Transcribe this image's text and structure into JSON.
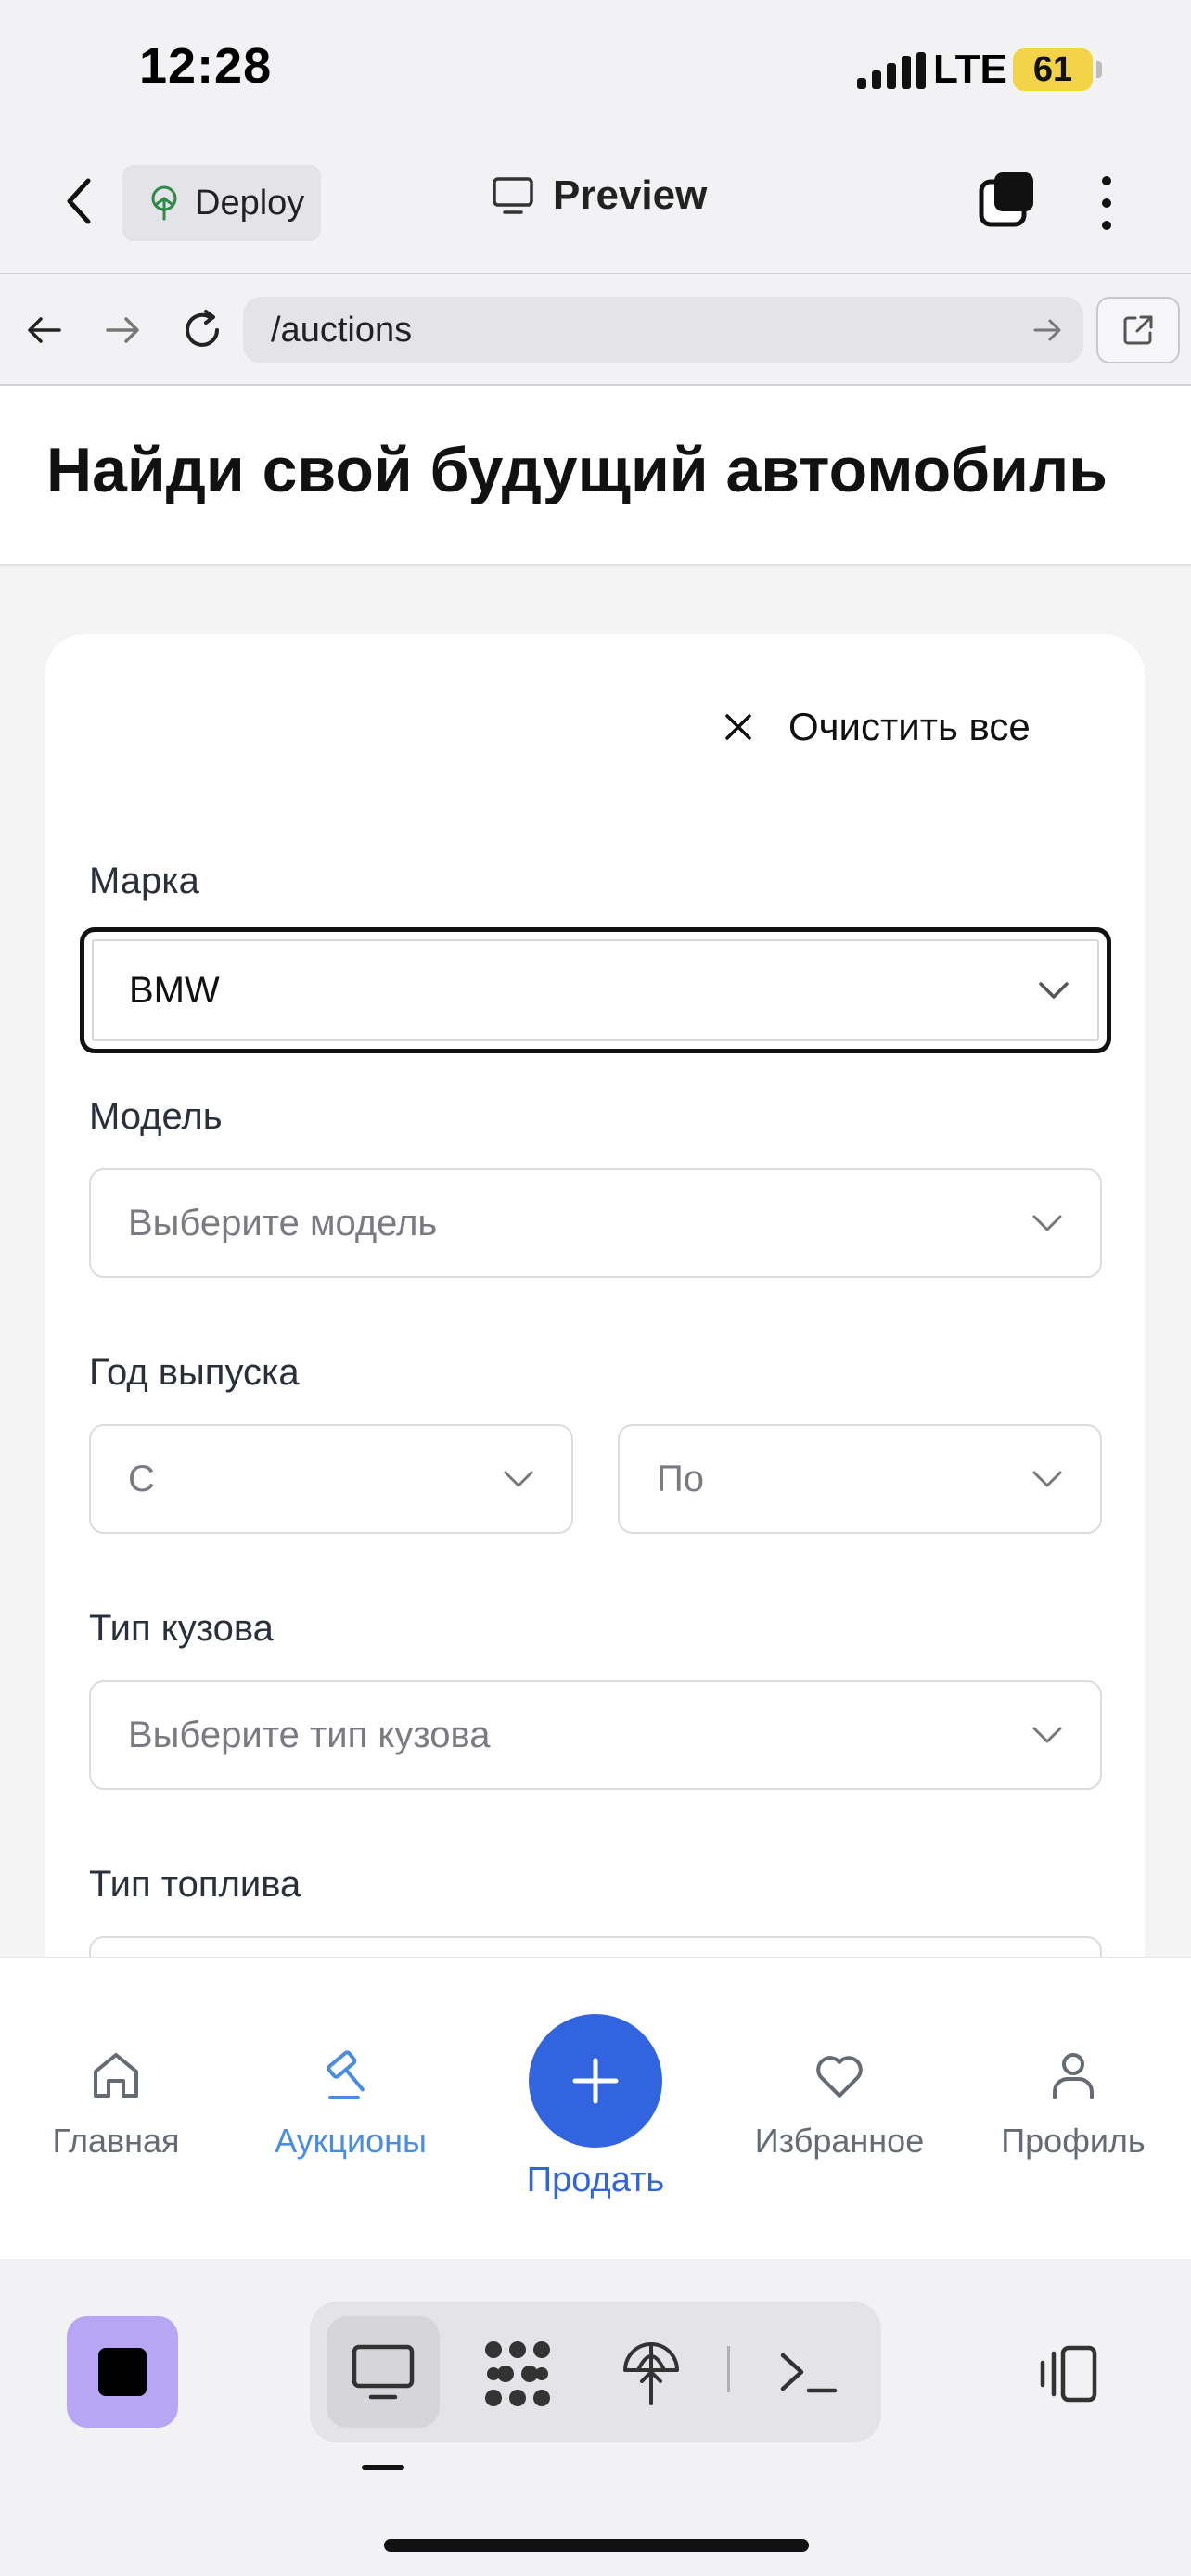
{
  "status_bar": {
    "time": "12:28",
    "network": "LTE",
    "battery": "61"
  },
  "toolbar": {
    "deploy_label": "Deploy",
    "preview_label": "Preview"
  },
  "browser": {
    "url": "/auctions"
  },
  "page": {
    "title": "Найди свой будущий автомобиль"
  },
  "filters": {
    "clear_all": "Очистить все",
    "make": {
      "label": "Марка",
      "value": "BMW"
    },
    "model": {
      "label": "Модель",
      "placeholder": "Выберите модель"
    },
    "year": {
      "label": "Год выпуска",
      "from": "С",
      "to": "По"
    },
    "body": {
      "label": "Тип кузова",
      "placeholder": "Выберите тип кузова"
    },
    "fuel": {
      "label": "Тип топлива"
    }
  },
  "bottom_nav": {
    "home": "Главная",
    "auctions": "Аукционы",
    "sell": "Продать",
    "favorites": "Избранное",
    "profile": "Профиль",
    "active": "auctions",
    "accent_color": "#3364e0"
  },
  "icons": {
    "toolbar": [
      "back-icon",
      "deploy-icon",
      "monitor-icon",
      "tabs-icon",
      "more-icon"
    ],
    "browser": [
      "arrow-left-icon",
      "arrow-right-icon",
      "reload-icon",
      "go-icon",
      "external-link-icon"
    ],
    "dock": [
      "stop-icon",
      "monitor-icon",
      "network-icon",
      "deploy-icon",
      "terminal-icon",
      "layout-icon"
    ]
  }
}
